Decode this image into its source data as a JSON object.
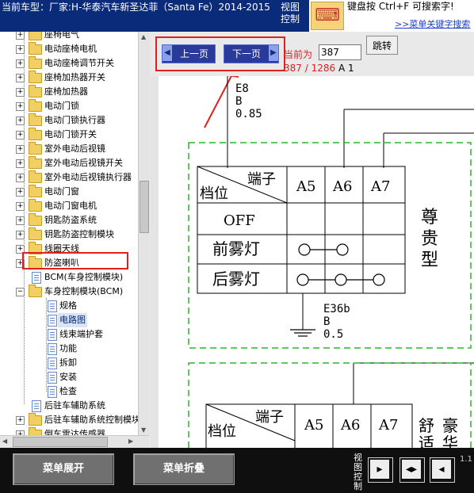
{
  "header": {
    "vehicle_label": "当前车型：厂家:H-华泰汽车新圣达菲（Santa Fe）2014-2015",
    "view_control": "视图控制",
    "promo_text": "键盘按 Ctrl+F 可搜索字!",
    "promo_link": ">>菜单关键字搜索"
  },
  "tree": {
    "items": [
      {
        "label": "座椅电气"
      },
      {
        "label": "电动座椅电机"
      },
      {
        "label": "电动座椅调节开关"
      },
      {
        "label": "座椅加热器开关"
      },
      {
        "label": "座椅加热器"
      },
      {
        "label": "电动门锁"
      },
      {
        "label": "电动门锁执行器"
      },
      {
        "label": "电动门锁开关"
      },
      {
        "label": "室外电动后视镜"
      },
      {
        "label": "室外电动后视镜开关"
      },
      {
        "label": "室外电动后视镜执行器"
      },
      {
        "label": "电动门窗"
      },
      {
        "label": "电动门窗电机"
      },
      {
        "label": "钥匙防盗系统"
      },
      {
        "label": "钥匙防盗控制模块"
      },
      {
        "label": "线圈天线"
      },
      {
        "label": "防盗喇叭"
      },
      {
        "label": "BCM(车身控制模块)"
      },
      {
        "label": "车身控制模块(BCM)"
      },
      {
        "label": "规格"
      },
      {
        "label": "电路图"
      },
      {
        "label": "线束端护套"
      },
      {
        "label": "功能"
      },
      {
        "label": "拆卸"
      },
      {
        "label": "安装"
      },
      {
        "label": "检查"
      },
      {
        "label": "后驻车辅助系统"
      },
      {
        "label": "后驻车辅助系统控制模块"
      },
      {
        "label": "倒车雷达传感器"
      }
    ]
  },
  "nav": {
    "prev_label": "上一页",
    "next_label": "下一页",
    "current_label": "当前为",
    "page_value": "387",
    "jump_label": "跳转",
    "page_pos": "387 / 1286",
    "page_suffix": "A 1"
  },
  "diagram": {
    "top_wire": {
      "code": "E8",
      "color": "B",
      "size": "0.85"
    },
    "bottom_wire": {
      "code": "E36b",
      "color": "B",
      "size": "0.5"
    },
    "table1": {
      "header_top": "端子",
      "header_bottom": "档位",
      "cols": [
        "A5",
        "A6",
        "A7"
      ],
      "rows": [
        "OFF",
        "前雾灯",
        "后雾灯"
      ],
      "variant": "尊贵型"
    },
    "table2": {
      "header_top": "端子",
      "header_bottom": "档位",
      "cols": [
        "A5",
        "A6",
        "A7"
      ],
      "variant_a": "舒适",
      "variant_b": "豪华"
    }
  },
  "bottom": {
    "expand_label": "菜单展开",
    "collapse_label": "菜单折叠",
    "view_control": "视图控制",
    "zoom": "1.1"
  }
}
